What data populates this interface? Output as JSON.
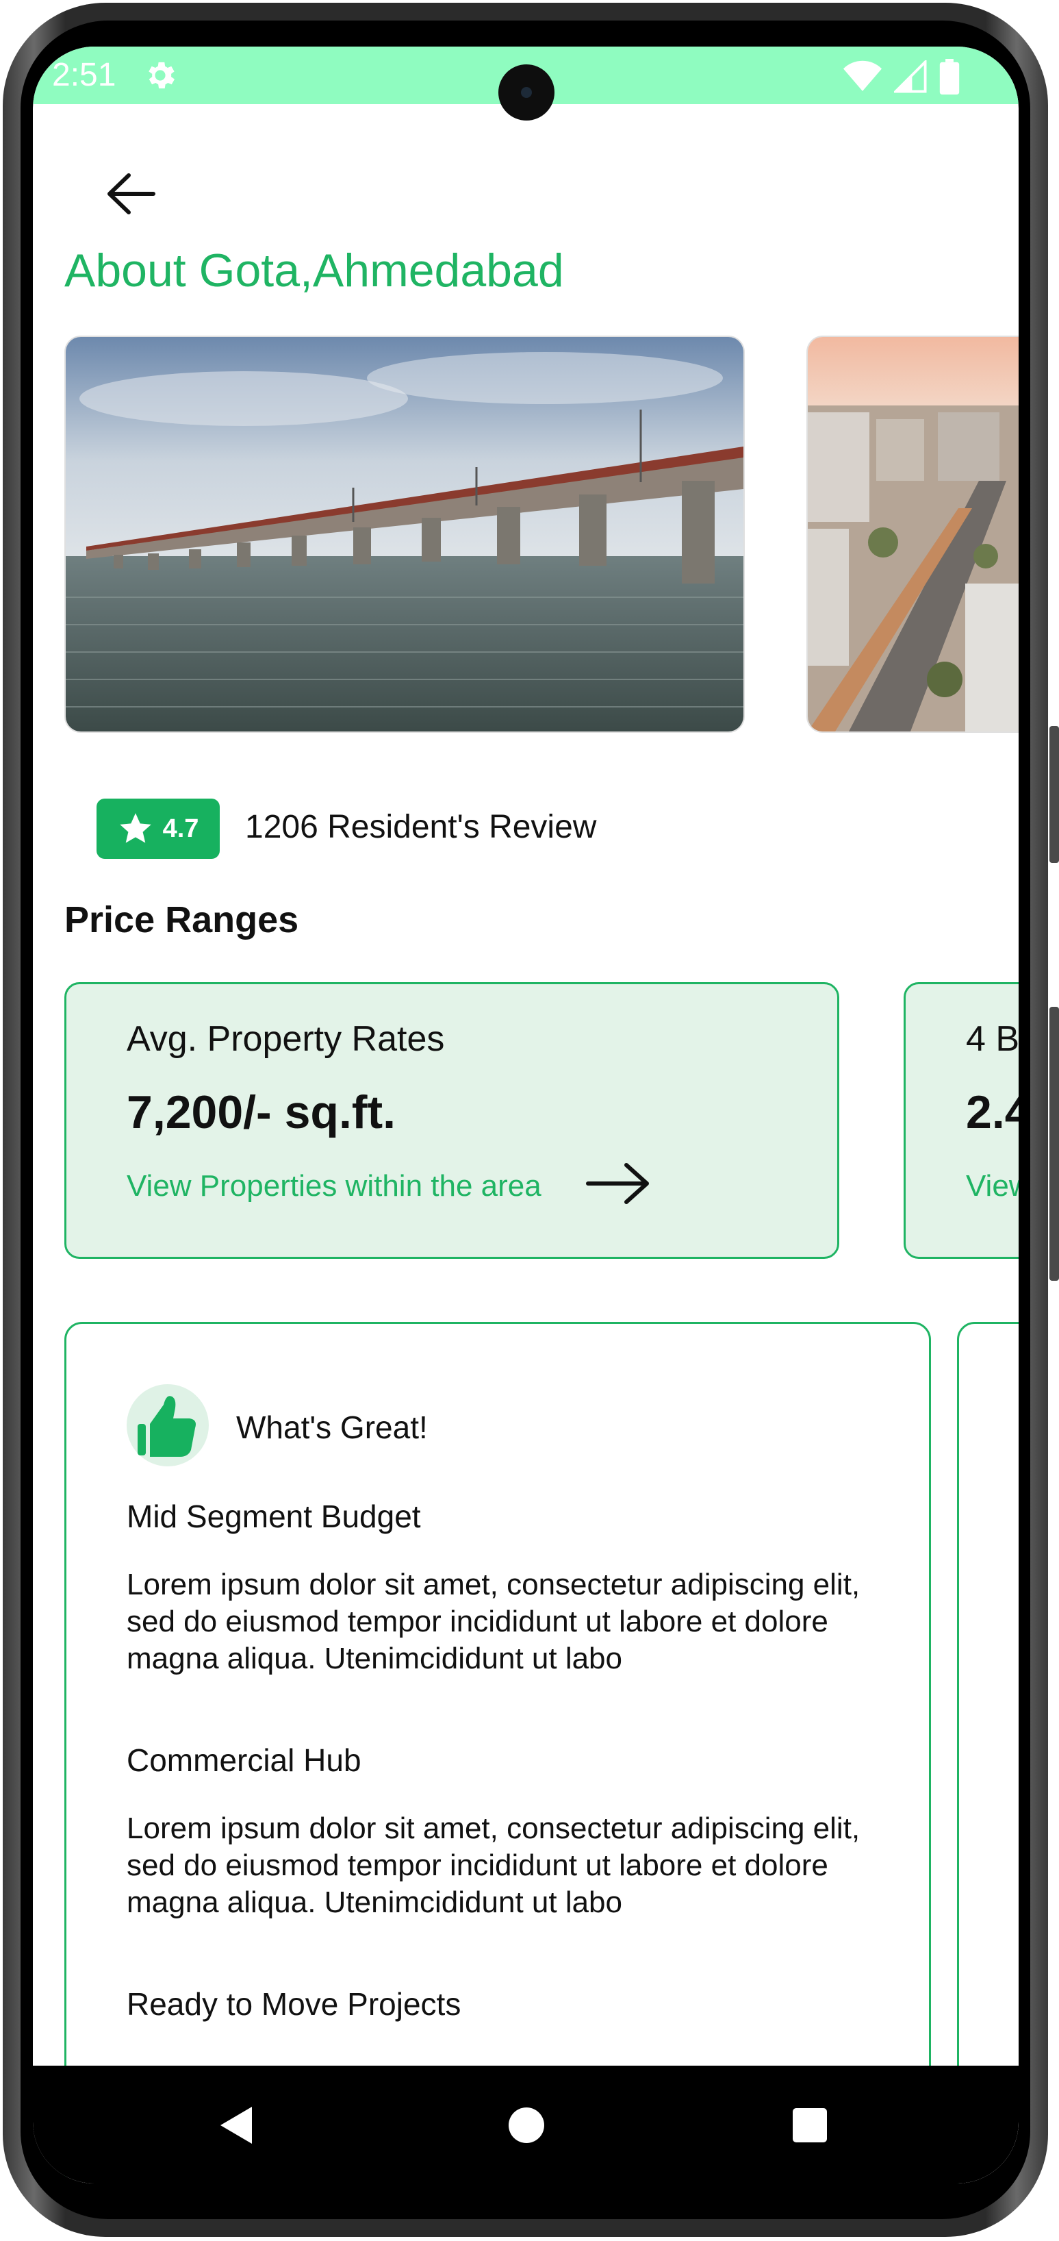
{
  "status_bar": {
    "time": "2:51",
    "icons": [
      "gear-icon",
      "wifi-icon",
      "signal-icon",
      "battery-icon"
    ]
  },
  "header": {
    "back_icon": "arrow-left-icon",
    "title": "About Gota,Ahmedabad"
  },
  "gallery": {
    "images": [
      "bridge-over-river-photo",
      "city-street-aerial-photo"
    ]
  },
  "rating": {
    "value": "4.7",
    "icon": "star-icon",
    "reviews_text": "1206 Resident's Review"
  },
  "price_ranges": {
    "title": "Price Ranges",
    "cards": [
      {
        "label": "Avg. Property Rates",
        "value": "7,200/- sq.ft.",
        "link": "View Properties within the area"
      },
      {
        "label": "4 B",
        "value": "2.4",
        "link": "View"
      }
    ]
  },
  "insights": {
    "heading": "What's Great!",
    "icon": "thumbs-up-icon",
    "items": [
      {
        "title": "Mid Segment Budget",
        "body": "Lorem ipsum dolor sit amet, consectetur adipiscing elit, sed do eiusmod tempor incididunt ut labore et dolore magna aliqua. Utenimcididunt ut labo"
      },
      {
        "title": "Commercial Hub",
        "body": "Lorem ipsum dolor sit amet, consectetur adipiscing elit, sed do eiusmod tempor incididunt ut labore et dolore magna aliqua. Utenimcididunt ut labo"
      },
      {
        "title": "Ready to Move Projects",
        "body": ""
      }
    ]
  },
  "nav_bar": {
    "buttons": [
      "back-triangle-icon",
      "home-circle-icon",
      "recents-square-icon"
    ]
  },
  "colors": {
    "accent": "#1fb463",
    "status_bar": "#8ffcc0",
    "card_bg": "#e3f3e8"
  }
}
